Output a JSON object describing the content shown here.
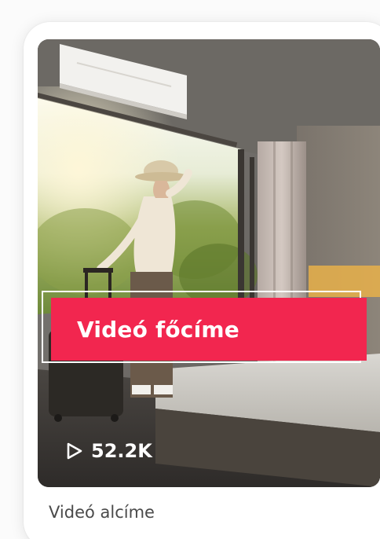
{
  "video_card": {
    "title": "Videó főcíme",
    "views": "52.2K",
    "subtitle": "Videó alcíme",
    "icons": {
      "play": "play-outline-icon"
    },
    "colors": {
      "title_background": "#f2264f",
      "title_text": "#ffffff",
      "subtitle_text": "#4a4a4a"
    }
  }
}
